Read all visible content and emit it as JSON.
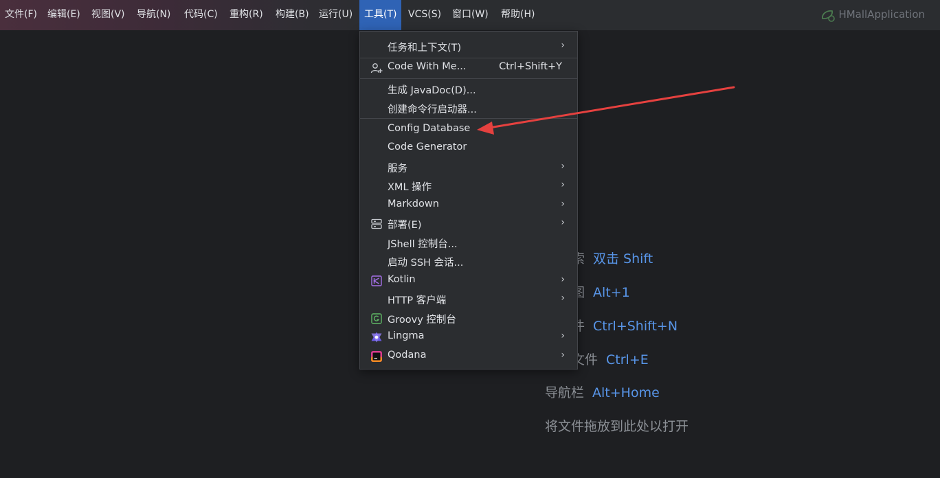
{
  "menubar": {
    "items": [
      {
        "label": "文件(F)"
      },
      {
        "label": "编辑(E)"
      },
      {
        "label": "视图(V)"
      },
      {
        "label": "导航(N)"
      },
      {
        "label": "代码(C)"
      },
      {
        "label": "重构(R)"
      },
      {
        "label": "构建(B)"
      },
      {
        "label": "运行(U)"
      },
      {
        "label": "工具(T)"
      },
      {
        "label": "VCS(S)"
      },
      {
        "label": "窗口(W)"
      },
      {
        "label": "帮助(H)"
      }
    ],
    "run_config": "HMallApplication"
  },
  "dropdown": {
    "items": [
      {
        "label": "任务和上下文(T)"
      },
      {
        "label": "Code With Me...",
        "shortcut": "Ctrl+Shift+Y"
      },
      {
        "label": "生成 JavaDoc(D)..."
      },
      {
        "label": "创建命令行启动器..."
      },
      {
        "label": "Config Database"
      },
      {
        "label": "Code Generator"
      },
      {
        "label": "服务"
      },
      {
        "label": "XML 操作"
      },
      {
        "label": "Markdown"
      },
      {
        "label": "部署(E)"
      },
      {
        "label": "JShell 控制台..."
      },
      {
        "label": "启动 SSH 会话..."
      },
      {
        "label": "Kotlin"
      },
      {
        "label": "HTTP 客户端"
      },
      {
        "label": "Groovy 控制台"
      },
      {
        "label": "Lingma"
      },
      {
        "label": "Qodana"
      }
    ]
  },
  "editor_hints": [
    {
      "text": "搜索",
      "key": "双击 Shift"
    },
    {
      "text": "视图",
      "key": "Alt+1"
    },
    {
      "text": "文件",
      "key": "Ctrl+Shift+N"
    },
    {
      "text": "约文件",
      "key": "Ctrl+E"
    },
    {
      "text": "导航栏",
      "key": "Alt+Home"
    },
    {
      "text": "将文件拖放到此处以打开",
      "key": ""
    }
  ],
  "colors": {
    "menu_active": "#2f63b5",
    "shortcut_key": "#5895e8",
    "annotation_arrow": "#e5413f"
  }
}
